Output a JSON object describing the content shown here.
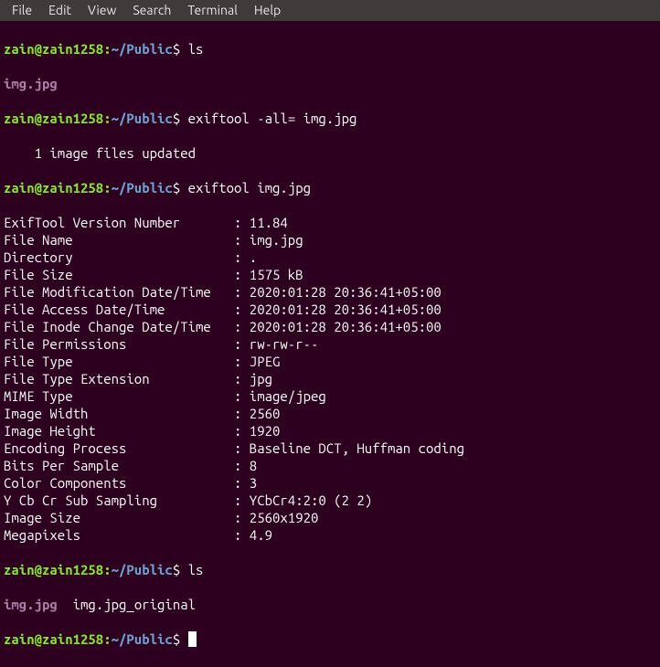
{
  "menubar": {
    "file": "File",
    "edit": "Edit",
    "view": "View",
    "search": "Search",
    "terminal": "Terminal",
    "help": "Help"
  },
  "prompt": {
    "userhost": "zain@zain1258",
    "sep1": ":",
    "path": "~/Public",
    "dollar": "$"
  },
  "cmds": {
    "ls1": "ls",
    "exif_strip": "exiftool -all= img.jpg",
    "exif_show": "exiftool img.jpg",
    "ls2": "ls"
  },
  "outputs": {
    "img_file": "img.jpg",
    "updated_msg": "    1 image files updated",
    "ls2_rest": "  img.jpg_original"
  },
  "exif": [
    {
      "k": "ExifTool Version Number",
      "v": "11.84"
    },
    {
      "k": "File Name",
      "v": "img.jpg"
    },
    {
      "k": "Directory",
      "v": "."
    },
    {
      "k": "File Size",
      "v": "1575 kB"
    },
    {
      "k": "File Modification Date/Time",
      "v": "2020:01:28 20:36:41+05:00"
    },
    {
      "k": "File Access Date/Time",
      "v": "2020:01:28 20:36:41+05:00"
    },
    {
      "k": "File Inode Change Date/Time",
      "v": "2020:01:28 20:36:41+05:00"
    },
    {
      "k": "File Permissions",
      "v": "rw-rw-r--"
    },
    {
      "k": "File Type",
      "v": "JPEG"
    },
    {
      "k": "File Type Extension",
      "v": "jpg"
    },
    {
      "k": "MIME Type",
      "v": "image/jpeg"
    },
    {
      "k": "Image Width",
      "v": "2560"
    },
    {
      "k": "Image Height",
      "v": "1920"
    },
    {
      "k": "Encoding Process",
      "v": "Baseline DCT, Huffman coding"
    },
    {
      "k": "Bits Per Sample",
      "v": "8"
    },
    {
      "k": "Color Components",
      "v": "3"
    },
    {
      "k": "Y Cb Cr Sub Sampling",
      "v": "YCbCr4:2:0 (2 2)"
    },
    {
      "k": "Image Size",
      "v": "2560x1920"
    },
    {
      "k": "Megapixels",
      "v": "4.9"
    }
  ]
}
